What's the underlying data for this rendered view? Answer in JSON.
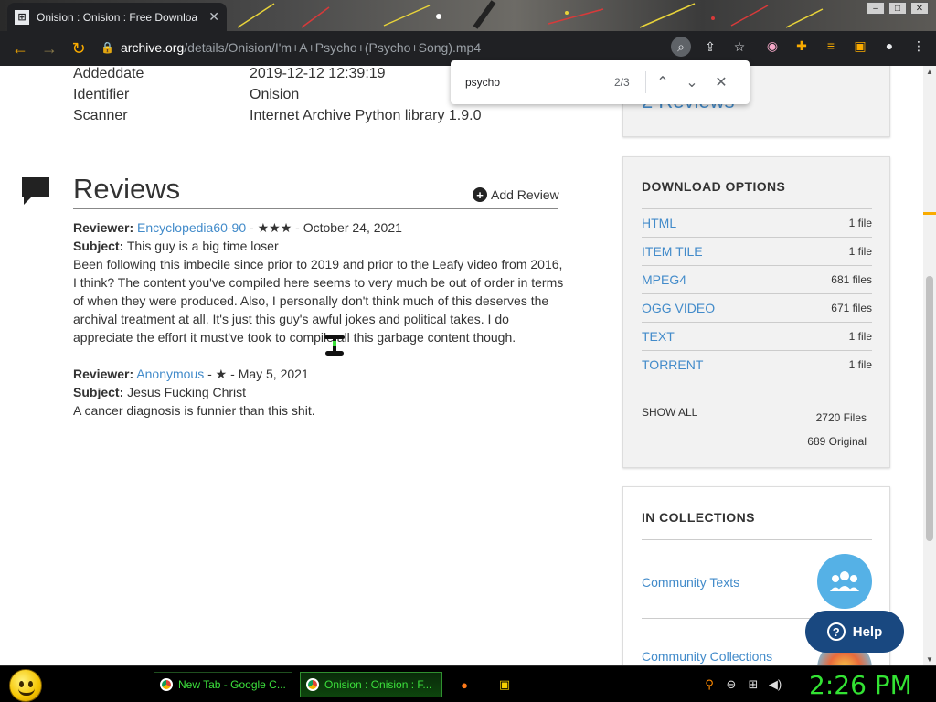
{
  "browser": {
    "tab_title": "Onision : Onision : Free Downloa",
    "tab_icon": "archive-icon",
    "url_host": "archive.org",
    "url_path": "/details/Onision/I'm+A+Psycho+(Psycho+Song).mp4"
  },
  "find_bar": {
    "query": "psycho",
    "count": "2/3"
  },
  "metadata": [
    {
      "key": "Addeddate",
      "value": "2019-12-12 12:39:19"
    },
    {
      "key": "Identifier",
      "value": "Onision"
    },
    {
      "key": "Scanner",
      "value": "Internet Archive Python library 1.9.0"
    }
  ],
  "reviews": {
    "title": "Reviews",
    "add_label": "Add Review",
    "items": [
      {
        "reviewer_label": "Reviewer:",
        "reviewer": "Encyclopedia60-90",
        "stars": "★★★",
        "date": "October 24, 2021",
        "subject_label": "Subject:",
        "subject": "This guy is a big time loser",
        "body": "Been following this imbecile since prior to 2019 and prior to the Leafy video from 2016, I think? The content you've compiled here seems to very much be out of order in terms of when they were produced. Also, I personally don't think much of this deserves the archival treatment at all. It's just this guy's awful jokes and political takes. I do appreciate the effort it must've took to compile all this garbage content though."
      },
      {
        "reviewer_label": "Reviewer:",
        "reviewer": "Anonymous",
        "stars": "★",
        "date": "May 5, 2021",
        "subject_label": "Subject:",
        "subject": "Jesus Fucking Christ",
        "body": "A cancer diagnosis is funnier than this shit."
      }
    ]
  },
  "sidebar": {
    "review_count": "2 Reviews",
    "download_options": {
      "title": "DOWNLOAD OPTIONS",
      "formats": [
        {
          "label": "HTML",
          "count": "1 file"
        },
        {
          "label": "ITEM TILE",
          "count": "1 file"
        },
        {
          "label": "MPEG4",
          "count": "681 files"
        },
        {
          "label": "OGG VIDEO",
          "count": "671 files"
        },
        {
          "label": "TEXT",
          "count": "1 file"
        },
        {
          "label": "TORRENT",
          "count": "1 file"
        }
      ],
      "show_all": "SHOW ALL",
      "total": "2720 Files",
      "original": "689 Original"
    },
    "collections": {
      "title": "IN COLLECTIONS",
      "items": [
        "Community Texts",
        "Community Collections"
      ]
    }
  },
  "help": {
    "label": "Help"
  },
  "taskbar": {
    "tasks": [
      "New Tab - Google C...",
      "Onision : Onision : F..."
    ],
    "clock": "2:26 PM"
  },
  "colors": {
    "link": "#428bca",
    "help_button": "#194880",
    "clock": "#33e333"
  }
}
